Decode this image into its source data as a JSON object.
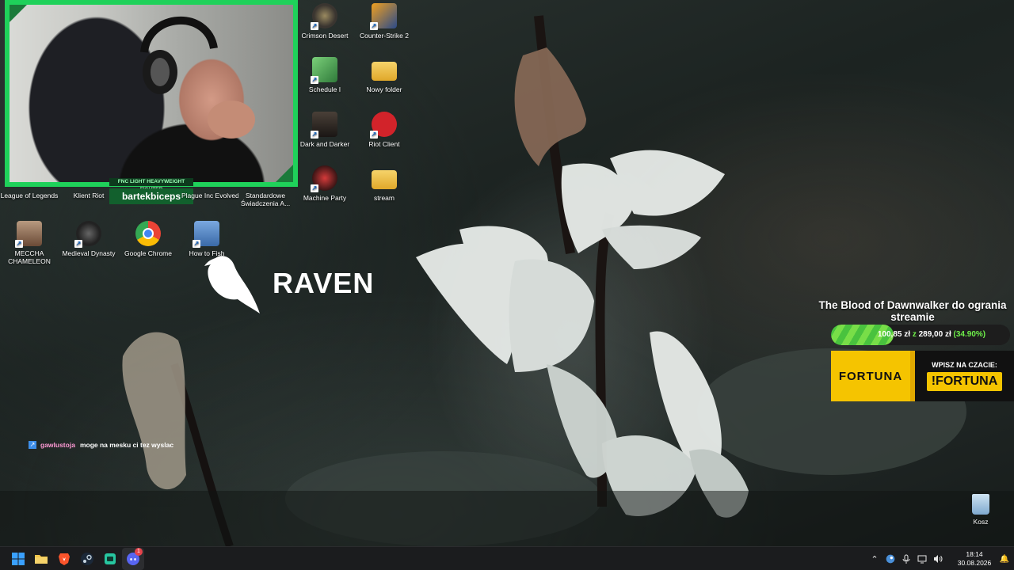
{
  "desktop": {
    "icons": [
      {
        "label": "Crimson Desert",
        "icon": "crimson-desert-icon",
        "color": "#3a3530"
      },
      {
        "label": "Counter-Strike 2",
        "icon": "counter-strike-icon",
        "color": "#2a4a8a"
      },
      {
        "label": "Schedule I",
        "icon": "schedule-i-icon",
        "color": "#2f7a3a"
      },
      {
        "label": "Nowy folder",
        "icon": "folder-icon",
        "color": "#f0c040"
      },
      {
        "label": "Dark and Darker",
        "icon": "dark-and-darker-icon",
        "color": "#2a2622"
      },
      {
        "label": "Riot Client",
        "icon": "riot-client-icon",
        "color": "#d2232a"
      },
      {
        "label": "Machine Party",
        "icon": "machine-party-icon",
        "color": "#3a1515"
      },
      {
        "label": "stream",
        "icon": "folder-icon",
        "color": "#f0c040"
      },
      {
        "label": "League of Legends",
        "icon": "league-of-legends-icon",
        "color": "#1a2a3a"
      },
      {
        "label": "Klient Riot",
        "icon": "riot-client-icon",
        "color": "#d2232a"
      },
      {
        "label": "Plague Inc Evolved",
        "icon": "plague-inc-icon",
        "color": "#5a1a1a"
      },
      {
        "label": "Standardowe Świadczenia A...",
        "icon": "document-icon",
        "color": "#e8e8e8"
      },
      {
        "label": "MECCHA CHAMELEON",
        "icon": "meccha-chameleon-icon",
        "color": "#8a6a50"
      },
      {
        "label": "Medieval Dynasty",
        "icon": "medieval-dynasty-icon",
        "color": "#222"
      },
      {
        "label": "Google Chrome",
        "icon": "chrome-icon",
        "color": "#4285f4"
      },
      {
        "label": "How to Fish",
        "icon": "how-to-fish-icon",
        "color": "#5a8ac8"
      },
      {
        "label": "Kosz",
        "icon": "recycle-bin-icon",
        "color": "#8ab4d8"
      }
    ]
  },
  "stream_overlay": {
    "webcam_caption": "FNC LIGHT HEAVYWEIGHT FIGHTER",
    "webcam_name": "bartekbiceps",
    "raven_text": "RAVEN",
    "chat": {
      "user": "gawlustoja",
      "message": "moge na mesku ci tez wyslac"
    },
    "goal": {
      "title": "The Blood of Dawnwalker do ogrania streamie",
      "current": "100,85 zł",
      "separator": "z",
      "target": "289,00 zł",
      "percent_label": "(34.90%)",
      "progress": 0.349
    },
    "sponsor": {
      "logo": "FORTUNA",
      "cta": "WPISZ NA CZACIE:",
      "command": "!FORTUNA",
      "color": "#f5c400"
    }
  },
  "taskbar": {
    "pinned": [
      {
        "name": "start-icon"
      },
      {
        "name": "file-explorer-icon"
      },
      {
        "name": "brave-icon"
      },
      {
        "name": "steam-icon"
      },
      {
        "name": "greenapp-icon"
      },
      {
        "name": "discord-icon",
        "badge": "1"
      }
    ],
    "clock_time": "18:14",
    "clock_date": "30.08.2026",
    "tray": [
      "chevron-up-icon",
      "steam-tray-icon",
      "microphone-icon",
      "network-icon",
      "speaker-icon"
    ]
  }
}
